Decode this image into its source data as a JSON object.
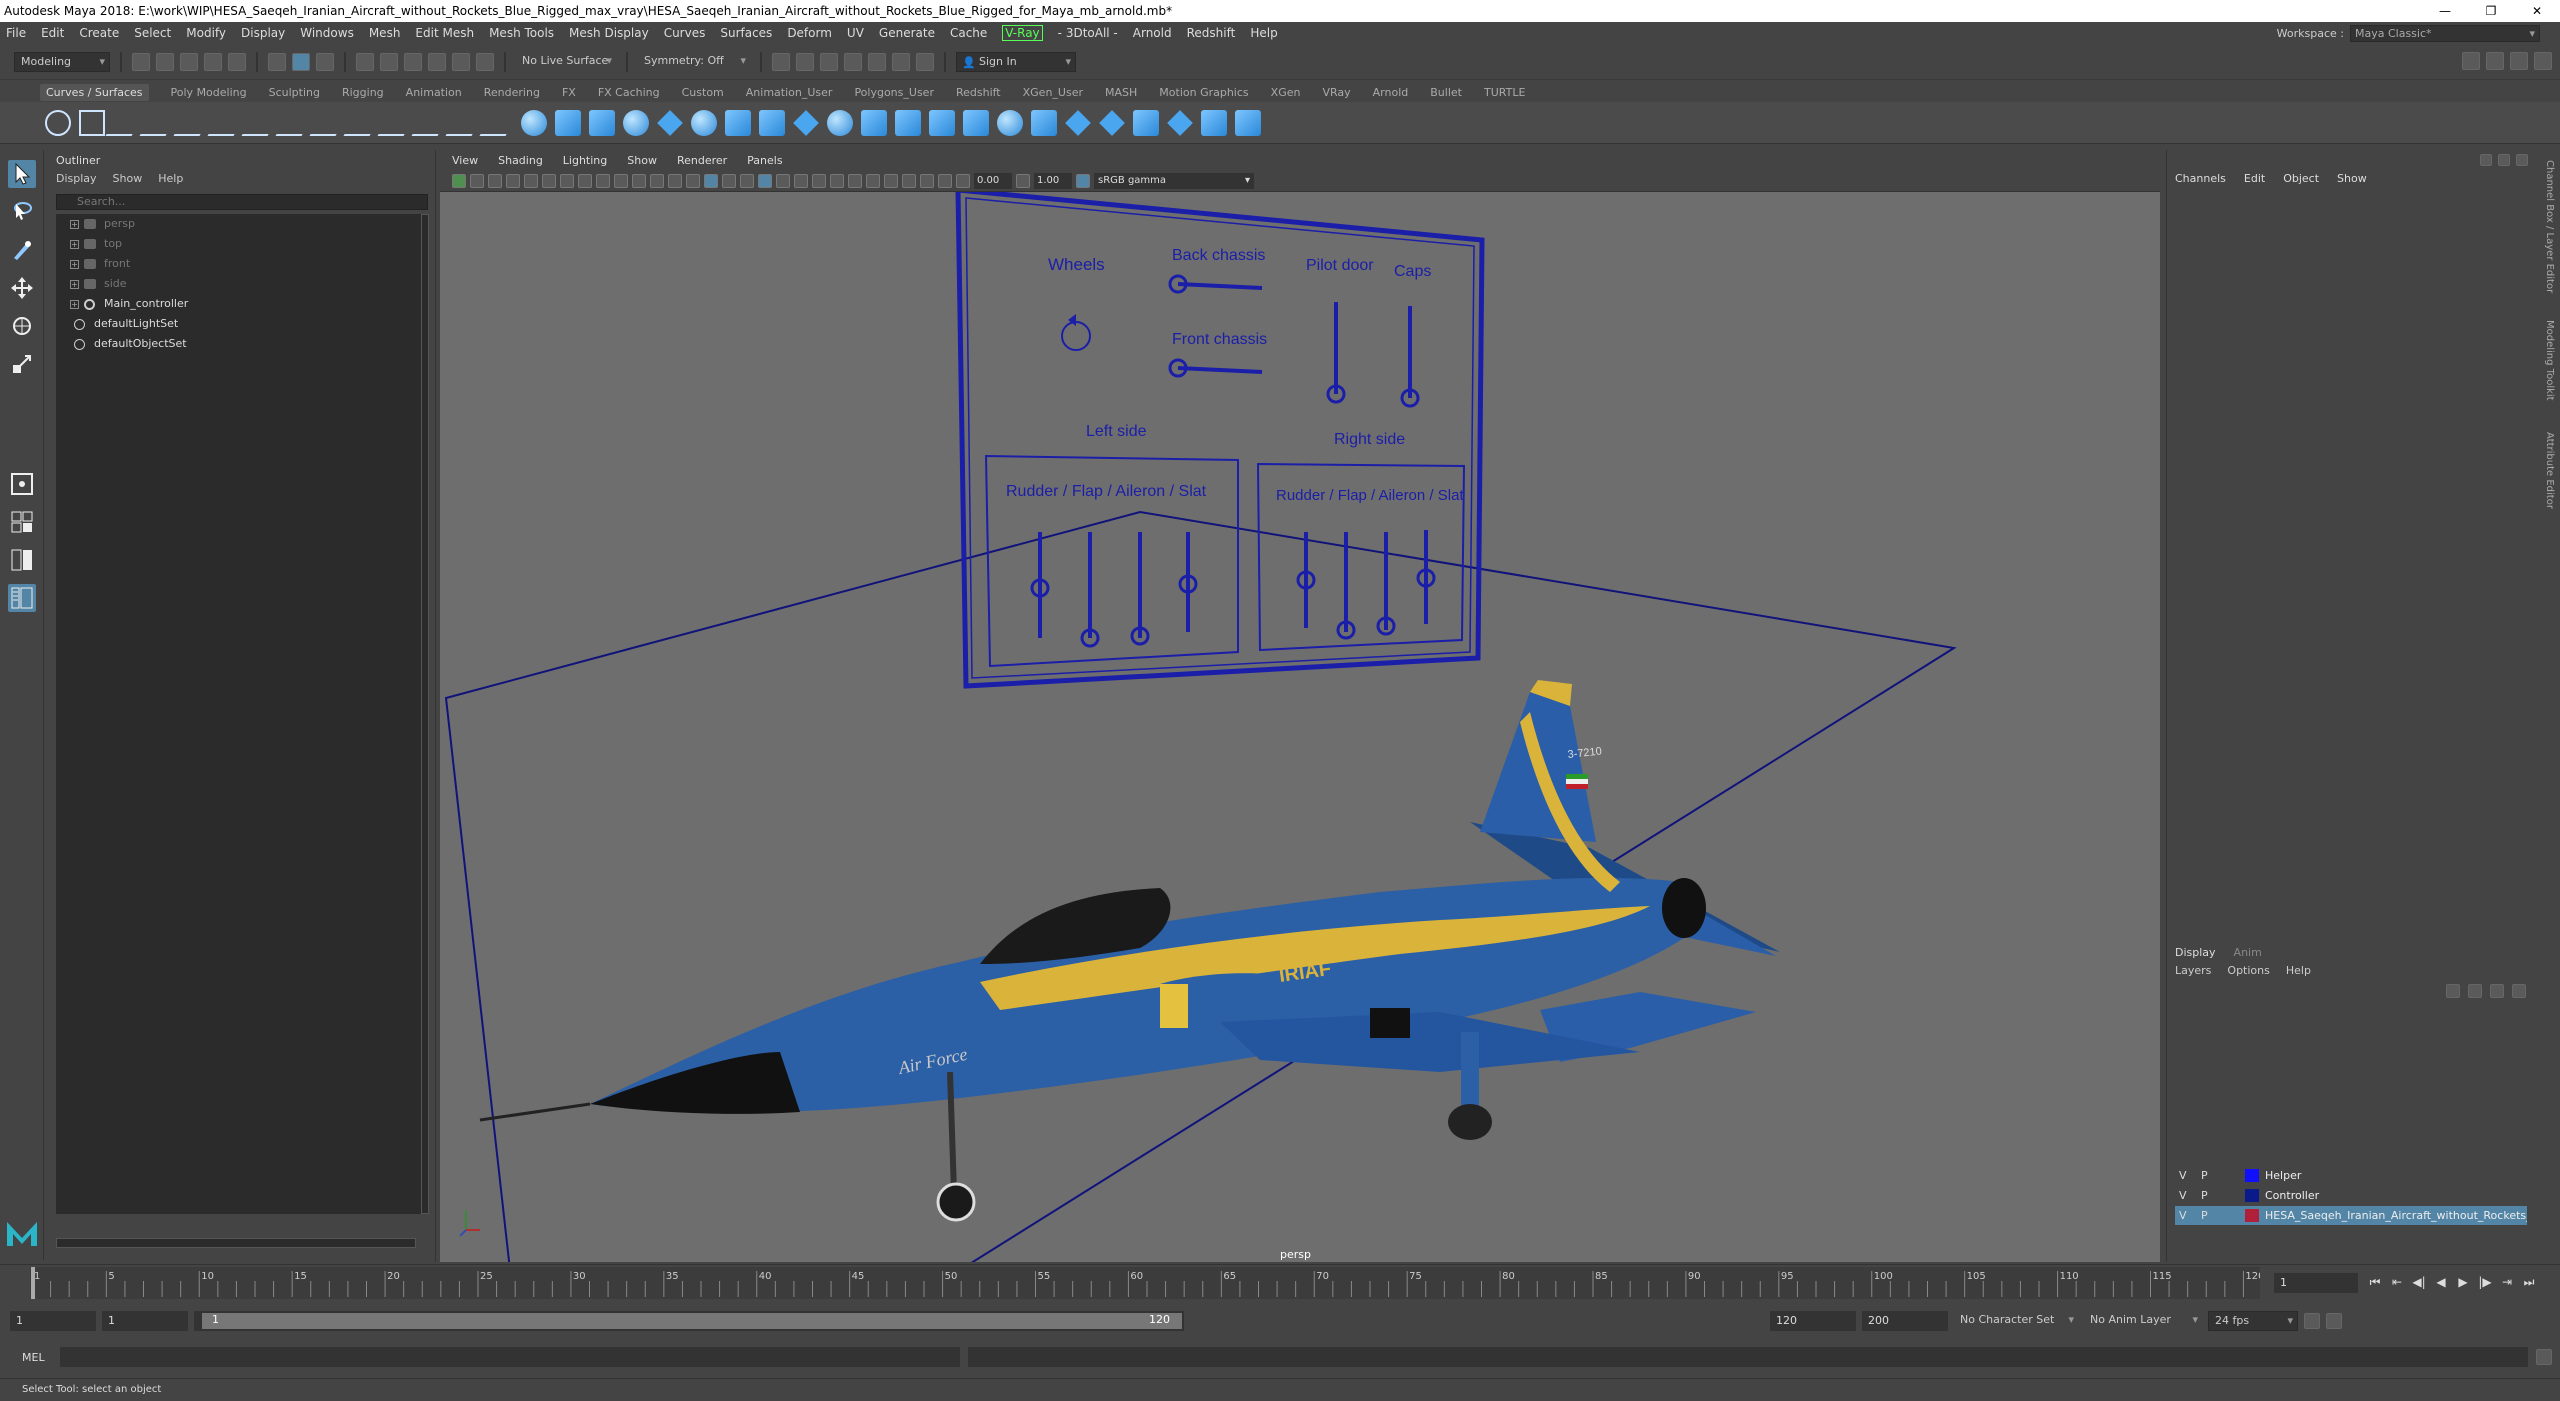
{
  "title_bar": {
    "text": "Autodesk Maya 2018: E:\\work\\WIP\\HESA_Saeqeh_Iranian_Aircraft_without_Rockets_Blue_Rigged_max_vray\\HESA_Saeqeh_Iranian_Aircraft_without_Rockets_Blue_Rigged_for_Maya_mb_arnold.mb*",
    "minimize": "—",
    "maximize": "❐",
    "close": "✕"
  },
  "menu_bar": {
    "items": [
      "File",
      "Edit",
      "Create",
      "Select",
      "Modify",
      "Display",
      "Windows",
      "Mesh",
      "Edit Mesh",
      "Mesh Tools",
      "Mesh Display",
      "Curves",
      "Surfaces",
      "Deform",
      "UV",
      "Generate",
      "Cache",
      "V-Ray",
      "- 3DtoAll -",
      "Arnold",
      "Redshift",
      "Help"
    ],
    "workspace_label": "Workspace :",
    "workspace_value": "Maya Classic*"
  },
  "status_line": {
    "mode": "Modeling",
    "live_surface": "No Live Surface",
    "symmetry": "Symmetry: Off",
    "sign_in": "Sign In"
  },
  "shelf_tabs": [
    "Curves / Surfaces",
    "Poly Modeling",
    "Sculpting",
    "Rigging",
    "Animation",
    "Rendering",
    "FX",
    "FX Caching",
    "Custom",
    "Animation_User",
    "Polygons_User",
    "Redshift",
    "XGen_User",
    "MASH",
    "Motion Graphics",
    "XGen",
    "VRay",
    "Arnold",
    "Bullet",
    "TURTLE"
  ],
  "outliner": {
    "title": "Outliner",
    "menu": [
      "Display",
      "Show",
      "Help"
    ],
    "search_placeholder": "Search...",
    "items": [
      {
        "label": "persp",
        "type": "camera",
        "dim": true
      },
      {
        "label": "top",
        "type": "camera",
        "dim": true
      },
      {
        "label": "front",
        "type": "camera",
        "dim": true
      },
      {
        "label": "side",
        "type": "camera",
        "dim": true
      },
      {
        "label": "Main_controller",
        "type": "transform",
        "dim": false
      },
      {
        "label": "defaultLightSet",
        "type": "set",
        "dim": false
      },
      {
        "label": "defaultObjectSet",
        "type": "set",
        "dim": false
      }
    ]
  },
  "viewport": {
    "menu": [
      "View",
      "Shading",
      "Lighting",
      "Show",
      "Renderer",
      "Panels"
    ],
    "exposure": "0.00",
    "gamma": "1.00",
    "color_space": "sRGB gamma",
    "camera": "persp",
    "control_panel": {
      "wheels": "Wheels",
      "back_chassis": "Back chassis",
      "front_chassis": "Front chassis",
      "pilot_door": "Pilot door",
      "caps": "Caps",
      "left_side": "Left side",
      "right_side": "Right side",
      "rudder_left": "Rudder / Flap / Aileron / Slat",
      "rudder_right": "Rudder / Flap / Aileron / Slat"
    },
    "aircraft_text": {
      "brand": "IRIAF",
      "script": "Air Force",
      "tail": "3-7210"
    }
  },
  "channel_box": {
    "menu": [
      "Channels",
      "Edit",
      "Object",
      "Show"
    ],
    "layer_tabs": [
      "Display",
      "Anim"
    ],
    "layer_menu": [
      "Layers",
      "Options",
      "Help"
    ],
    "layers": [
      {
        "v": "V",
        "p": "P",
        "color": "#1010ff",
        "name": "Helper",
        "selected": false
      },
      {
        "v": "V",
        "p": "P",
        "color": "#0a1a8a",
        "name": "Controller",
        "selected": false
      },
      {
        "v": "V",
        "p": "P",
        "color": "#b0203a",
        "name": "HESA_Saeqeh_Iranian_Aircraft_without_Rockets_Blue_Rig",
        "selected": true
      }
    ]
  },
  "side_tabs": [
    "Channel Box / Layer Editor",
    "Modeling Toolkit",
    "Attribute Editor"
  ],
  "timeline": {
    "ticks": [
      "1",
      "5",
      "10",
      "15",
      "20",
      "25",
      "30",
      "35",
      "40",
      "45",
      "50",
      "55",
      "60",
      "65",
      "70",
      "75",
      "80",
      "85",
      "90",
      "95",
      "100",
      "105",
      "110",
      "115",
      "120"
    ],
    "current_frame": "1"
  },
  "range_bar": {
    "start": "1",
    "range_start": "1",
    "slider_start": "1",
    "slider_end": "120",
    "range_end": "120",
    "end": "200",
    "character_set": "No Character Set",
    "anim_layer": "No Anim Layer",
    "fps": "24 fps"
  },
  "command_line": {
    "label": "MEL"
  },
  "help_line": {
    "text": "Select Tool: select an object"
  }
}
